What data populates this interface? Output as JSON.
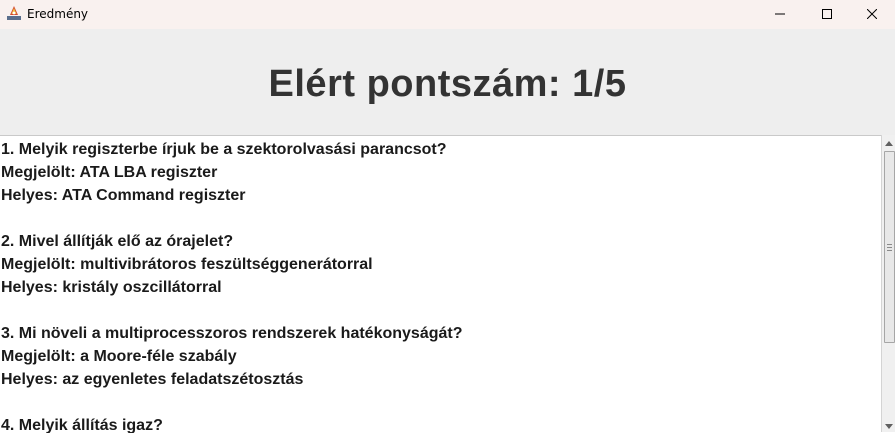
{
  "window": {
    "title": "Eredmény",
    "controls": [
      "minimize-icon",
      "maximize-icon",
      "close-icon"
    ]
  },
  "header": {
    "score_title": "Elért pontszám: 1/5"
  },
  "results": [
    {
      "question": "1. Melyik regiszterbe írjuk be a szektorolvasási parancsot?",
      "marked": "Megjelölt: ATA LBA regiszter",
      "correct": "Helyes: ATA Command regiszter"
    },
    {
      "question": "2. Mivel állítják elő az órajelet?",
      "marked": "Megjelölt: multivibrátoros feszültséggenerátorral",
      "correct": "Helyes: kristály oszcillátorral"
    },
    {
      "question": "3. Mi növeli a multiprocesszoros rendszerek hatékonyságát?",
      "marked": "Megjelölt: a Moore-féle szabály",
      "correct": "Helyes: az egyenletes feladatszétosztás"
    },
    {
      "question": "4. Melyik állítás igaz?"
    }
  ],
  "colors": {
    "titlebar_bg": "#f9f1ef",
    "header_bg": "#eeeeee",
    "title_text": "#333333",
    "body_text": "#1a1a1a"
  }
}
